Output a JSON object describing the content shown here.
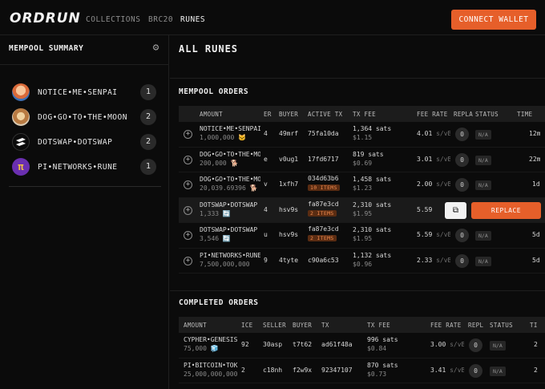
{
  "brand": {
    "logo": "ORDRUN",
    "accent": "#e65f2a"
  },
  "nav": {
    "items": [
      "COLLECTIONS",
      "BRC20",
      "RUNES"
    ],
    "active": "RUNES",
    "connect_label": "CONNECT WALLET"
  },
  "sidebar": {
    "title": "MEMPOOL SUMMARY",
    "settings_icon": "gear-icon",
    "items": [
      {
        "name": "NOTICE•ME•SENPAI",
        "count": "1"
      },
      {
        "name": "DOG•GO•TO•THE•MOON",
        "count": "2"
      },
      {
        "name": "DOTSWAP•DOTSWAP",
        "count": "2"
      },
      {
        "name": "PI•NETWORKS•RUNE",
        "count": "1"
      }
    ]
  },
  "main": {
    "title": "ALL RUNES"
  },
  "mempool": {
    "title": "MEMPOOL ORDERS",
    "headers": {
      "amount": "AMOUNT",
      "seller": "ER",
      "buyer": "BUYER",
      "active_tx": "ACTIVE TX",
      "tx_fee": "TX FEE",
      "fee_rate": "FEE RATE",
      "replace": "REPLA",
      "status": "STATUS",
      "time": "TIME"
    },
    "rows": [
      {
        "name": "NOTICE•ME•SENPAI",
        "amount": "1,000,000 🐱",
        "seller": "4",
        "buyer": "49mrf",
        "tx": "75fa10da",
        "badge": "",
        "fee": "1,364 sats",
        "fee_usd": "$1.15",
        "rate": "4.01",
        "rate_unit": "s/vB",
        "replace": "0",
        "status": "N/A",
        "time": "12m"
      },
      {
        "name": "DOG•GO•TO•THE•MOON",
        "amount": "200,000 🐕",
        "seller": "e",
        "buyer": "v0ug1",
        "tx": "17fd6717",
        "badge": "",
        "fee": "819 sats",
        "fee_usd": "$0.69",
        "rate": "3.01",
        "rate_unit": "s/vB",
        "replace": "0",
        "status": "N/A",
        "time": "22m"
      },
      {
        "name": "DOG•GO•TO•THE•MOON",
        "amount": "20,039.69396 🐕",
        "seller": "v",
        "buyer": "1xfh7",
        "tx": "034d63b6",
        "badge": "10 ITEMS",
        "fee": "1,458 sats",
        "fee_usd": "$1.23",
        "rate": "2.00",
        "rate_unit": "s/vB",
        "replace": "0",
        "status": "N/A",
        "time": "1d"
      },
      {
        "name": "DOTSWAP•DOTSWAP",
        "amount": "1,333 🔄",
        "seller": "4",
        "buyer": "hsv9s",
        "tx": "fa87e3cd",
        "badge": "2 ITEMS",
        "fee": "2,310 sats",
        "fee_usd": "$1.95",
        "rate": "5.59",
        "rate_unit": "",
        "replace": "",
        "status": "",
        "time": "",
        "selected": true,
        "replace_label": "REPLACE",
        "copy_icon": "copy-icon"
      },
      {
        "name": "DOTSWAP•DOTSWAP",
        "amount": "3,546 🔄",
        "seller": "u",
        "buyer": "hsv9s",
        "tx": "fa87e3cd",
        "badge": "2 ITEMS",
        "fee": "2,310 sats",
        "fee_usd": "$1.95",
        "rate": "5.59",
        "rate_unit": "s/vB",
        "replace": "0",
        "status": "N/A",
        "time": "5d"
      },
      {
        "name": "PI•NETWORKS•RUNE",
        "amount": "7,500,000,000",
        "seller": "9",
        "buyer": "4tyte",
        "tx": "c90a6c53",
        "badge": "",
        "fee": "1,132 sats",
        "fee_usd": "$0.96",
        "rate": "2.33",
        "rate_unit": "s/vB",
        "replace": "0",
        "status": "N/A",
        "time": "5d"
      }
    ]
  },
  "completed": {
    "title": "COMPLETED ORDERS",
    "headers": {
      "amount": "AMOUNT",
      "price": "ICE",
      "seller": "SELLER",
      "buyer": "BUYER",
      "tx": "TX",
      "tx_fee": "TX FEE",
      "fee_rate": "FEE RATE",
      "replace": "REPL",
      "status": "STATUS",
      "time": "TI"
    },
    "rows": [
      {
        "name": "CYPHER•GENESIS",
        "amount": "75,000 🧊",
        "price": "92",
        "seller": "30asp",
        "buyer": "t7t62",
        "tx": "ad61f48a",
        "fee": "996 sats",
        "fee_usd": "$0.84",
        "rate": "3.00",
        "rate_unit": "s/vB",
        "replace": "0",
        "status": "N/A",
        "time": "2"
      },
      {
        "name": "PI•BITCOIN•TOKEN",
        "amount": "25,000,000,000",
        "price": "2",
        "seller": "c18nh",
        "buyer": "f2w9x",
        "tx": "92347107",
        "fee": "870 sats",
        "fee_usd": "$0.73",
        "rate": "3.41",
        "rate_unit": "s/vB",
        "replace": "0",
        "status": "N/A",
        "time": "2"
      }
    ]
  }
}
